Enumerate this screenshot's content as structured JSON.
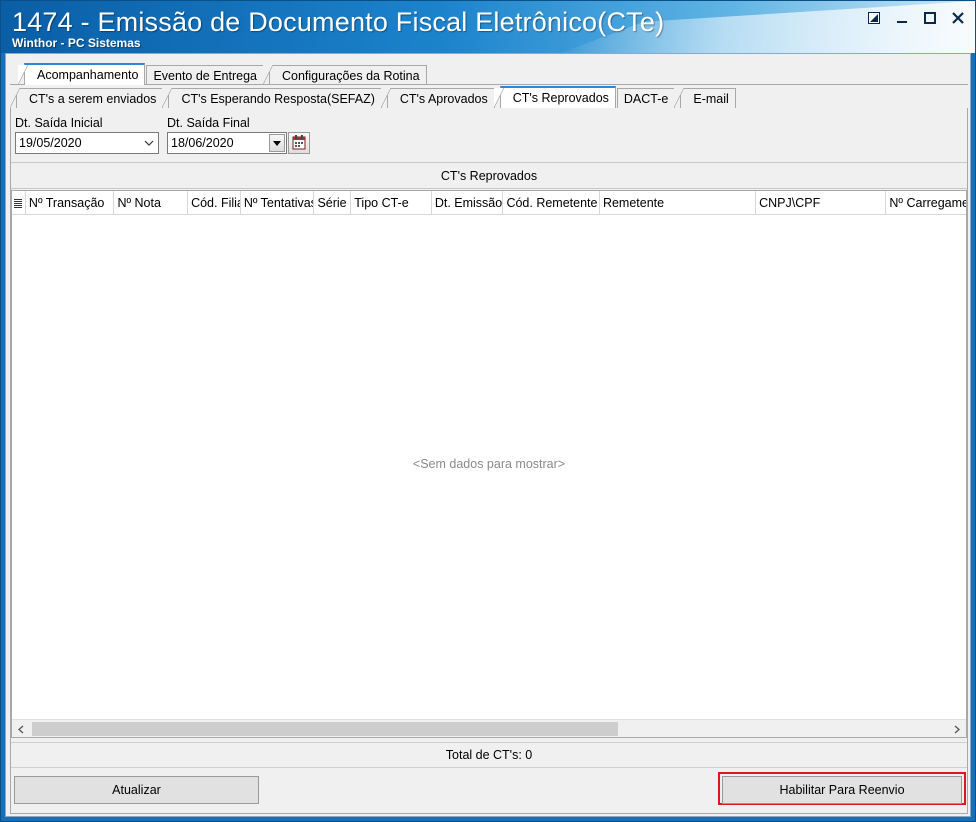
{
  "window": {
    "title": "1474 - Emissão de Documento Fiscal Eletrônico(CTe)",
    "subtitle": "Winthor - PC Sistemas"
  },
  "main_tabs": [
    {
      "label": "Acompanhamento",
      "active": true
    },
    {
      "label": "Evento de Entrega",
      "active": false
    },
    {
      "label": "Configurações da Rotina",
      "active": false
    }
  ],
  "sub_tabs": [
    {
      "label": "CT's a serem enviados",
      "active": false
    },
    {
      "label": "CT's Esperando Resposta(SEFAZ)",
      "active": false
    },
    {
      "label": "CT's Aprovados",
      "active": false
    },
    {
      "label": "CT's Reprovados",
      "active": true
    },
    {
      "label": "DACT-e",
      "active": false
    },
    {
      "label": "E-mail",
      "active": false
    }
  ],
  "filters": {
    "start_label": "Dt. Saída Inicial",
    "start_value": "19/05/2020",
    "end_label": "Dt. Saída Final",
    "end_value": "18/06/2020"
  },
  "grid": {
    "title": "CT's Reprovados",
    "columns": [
      "Nº Transação",
      "Nº Nota",
      "Cód. Filial",
      "Nº Tentativas",
      "Série",
      "Tipo CT-e",
      "Dt. Emissão",
      "Cód. Remetente",
      "Remetente",
      "CNPJ\\CPF",
      "Nº Carregamento"
    ],
    "empty_message": "<Sem dados para mostrar>",
    "total_label": "Total de CT's: 0"
  },
  "buttons": {
    "refresh": "Atualizar",
    "enable_resend": "Habilitar Para Reenvio"
  },
  "colors": {
    "highlight": "#e3141b",
    "active_tab_accent": "#2f86d6"
  }
}
